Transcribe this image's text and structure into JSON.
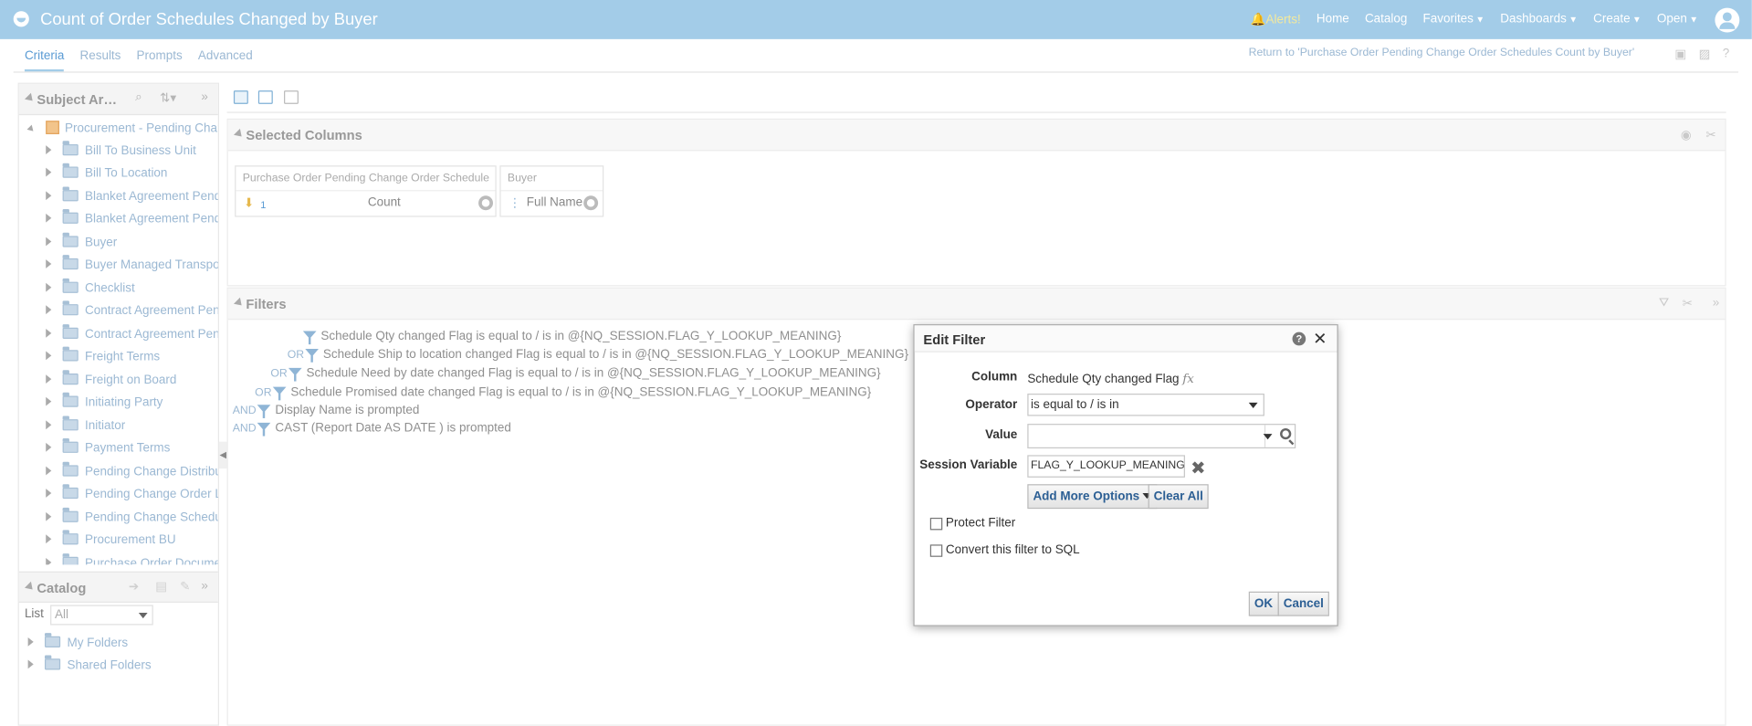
{
  "header": {
    "title": "Count of Order Schedules Changed by Buyer",
    "nav": [
      "Alerts!",
      "Home",
      "Catalog",
      "Favorites",
      "Dashboards",
      "Create",
      "Open"
    ]
  },
  "tabs": [
    "Criteria",
    "Results",
    "Prompts",
    "Advanced"
  ],
  "return_link": "Return to 'Purchase Order Pending Change Order Schedules Count by Buyer'",
  "subject_area": {
    "title": "Subject Ar…",
    "root": "Procurement - Pending Change",
    "items": [
      "Bill To Business Unit",
      "Bill To Location",
      "Blanket Agreement Pending",
      "Blanket Agreement Pending",
      "Buyer",
      "Buyer Managed Transportation",
      "Checklist",
      "Contract Agreement Pending",
      "Contract Agreement Pending",
      "Freight Terms",
      "Freight on Board",
      "Initiating Party",
      "Initiator",
      "Payment Terms",
      "Pending Change Distributions",
      "Pending Change Order Lines",
      "Pending Change Schedules",
      "Procurement BU",
      "Purchase Order Document"
    ]
  },
  "catalog": {
    "title": "Catalog",
    "list_label": "List",
    "list_value": "All",
    "folders": [
      "My Folders",
      "Shared Folders"
    ]
  },
  "selected_columns": {
    "title": "Selected Columns",
    "columns": [
      {
        "header": "Purchase Order Pending Change Order Schedule",
        "sort": "1",
        "name": "Count"
      },
      {
        "header": "Buyer",
        "name": "Full Name"
      }
    ]
  },
  "filters": {
    "title": "Filters",
    "lines": [
      {
        "op": "",
        "text": "Schedule Qty changed Flag is equal to / is in  @{NQ_SESSION.FLAG_Y_LOOKUP_MEANING}"
      },
      {
        "op": "OR",
        "text": "Schedule Ship to location changed Flag is equal to / is in  @{NQ_SESSION.FLAG_Y_LOOKUP_MEANING}"
      },
      {
        "op": "OR",
        "text": "Schedule Need by date changed Flag is equal to / is in  @{NQ_SESSION.FLAG_Y_LOOKUP_MEANING}"
      },
      {
        "op": "OR",
        "text": "Schedule Promised date changed Flag is equal to / is in  @{NQ_SESSION.FLAG_Y_LOOKUP_MEANING}"
      },
      {
        "op": "AND",
        "text": "Display Name is prompted"
      },
      {
        "op": "AND",
        "text": "CAST (Report Date AS DATE ) is prompted"
      }
    ]
  },
  "dialog": {
    "title": "Edit Filter",
    "column_label": "Column",
    "column_value": "Schedule Qty changed Flag",
    "operator_label": "Operator",
    "operator_value": "is equal to / is in",
    "value_label": "Value",
    "value_value": "",
    "session_label": "Session Variable",
    "session_value": "FLAG_Y_LOOKUP_MEANING",
    "add_more": "Add More Options",
    "clear_all": "Clear All",
    "protect_filter": "Protect Filter",
    "convert_sql": "Convert this filter to SQL",
    "ok": "OK",
    "cancel": "Cancel"
  }
}
